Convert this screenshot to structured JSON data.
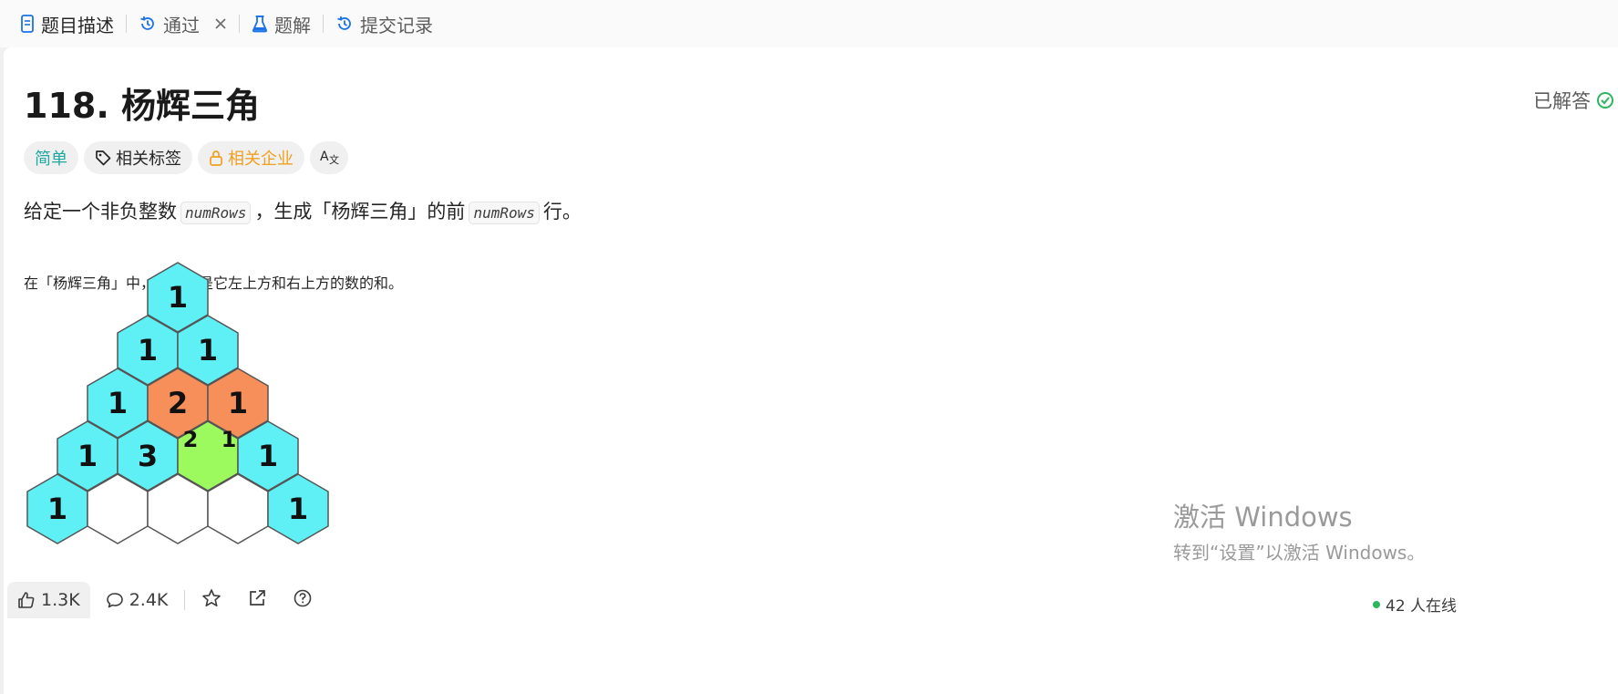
{
  "tabs": [
    {
      "label": "题目描述",
      "icon": "document-icon",
      "active": true
    },
    {
      "label": "通过",
      "icon": "history-icon",
      "closable": true
    },
    {
      "label": "题解",
      "icon": "flask-icon"
    },
    {
      "label": "提交记录",
      "icon": "history-icon"
    }
  ],
  "problem": {
    "title": "118. 杨辉三角",
    "status": "已解答",
    "tags": [
      {
        "label": "简单",
        "color": "#1fa7a0"
      },
      {
        "label": "相关标签",
        "icon": "tag-icon"
      },
      {
        "label": "相关企业",
        "icon": "lock-icon",
        "color": "#f0a020"
      },
      {
        "label": "A文",
        "icon": "translate-icon"
      }
    ],
    "desc_parts": [
      "给定一个非负整数",
      "numRows",
      "，生成「杨辉三角」的前",
      "numRows",
      "行。"
    ],
    "note": "在「杨辉三角」中，每个数是它左上方和右上方的数的和。"
  },
  "bottom": {
    "likes": "1.3K",
    "comments": "2.4K",
    "online": "42 人在线"
  },
  "watermark": {
    "line1": "激活 Windows",
    "line2": "转到“设置”以激活 Windows。"
  },
  "colors": {
    "cyan": "#5ff0f5",
    "orange": "#f78f5a",
    "green": "#9cf95e",
    "accent": "#1fa7a0",
    "company": "#f0a020"
  }
}
